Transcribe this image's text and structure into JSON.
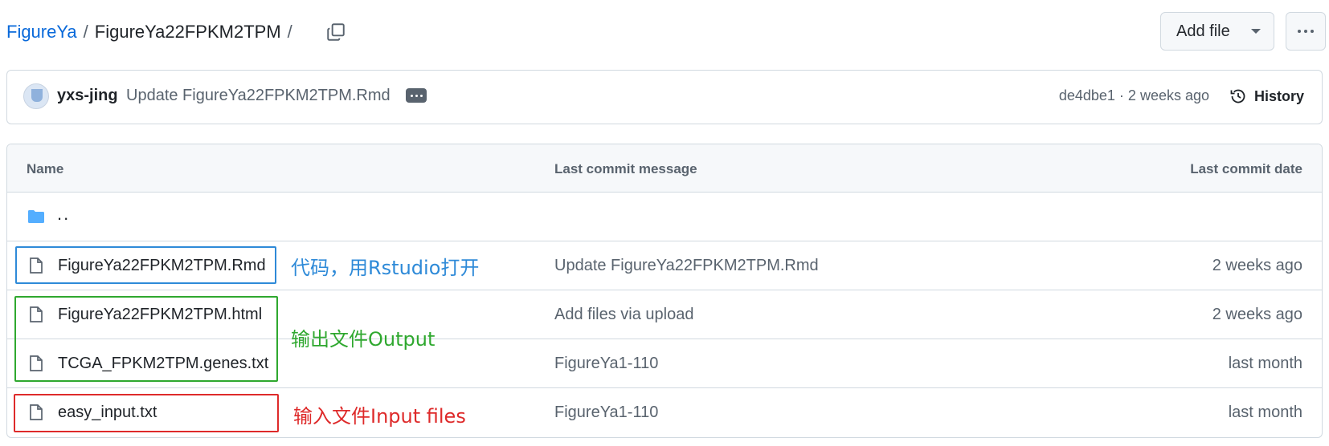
{
  "breadcrumb": {
    "repo": "FigureYa",
    "separator": "/",
    "folder": "FigureYa22FPKM2TPM",
    "trailing_separator": "/"
  },
  "toolbar": {
    "add_file_label": "Add file"
  },
  "commit": {
    "author": "yxs-jing",
    "message": "Update FigureYa22FPKM2TPM.Rmd",
    "meta": "de4dbe1 · 2 weeks ago",
    "history_label": "History"
  },
  "table": {
    "headers": {
      "name": "Name",
      "message": "Last commit message",
      "date": "Last commit date"
    },
    "parent_dir": "..",
    "rows": [
      {
        "name": "FigureYa22FPKM2TPM.Rmd",
        "message": "Update FigureYa22FPKM2TPM.Rmd",
        "date": "2 weeks ago"
      },
      {
        "name": "FigureYa22FPKM2TPM.html",
        "message": "Add files via upload",
        "date": "2 weeks ago"
      },
      {
        "name": "TCGA_FPKM2TPM.genes.txt",
        "message": "FigureYa1-110",
        "date": "last month"
      },
      {
        "name": "easy_input.txt",
        "message": "FigureYa1-110",
        "date": "last month"
      }
    ]
  },
  "annotations": {
    "code": "代码，用Rstudio打开",
    "output": "输出文件Output",
    "input": "输入文件Input files"
  },
  "colors": {
    "link": "#0969da",
    "folder_icon": "#54aeff",
    "annotation_blue": "#2e8ad8",
    "annotation_green": "#2fa82f",
    "annotation_red": "#de2a2a"
  }
}
